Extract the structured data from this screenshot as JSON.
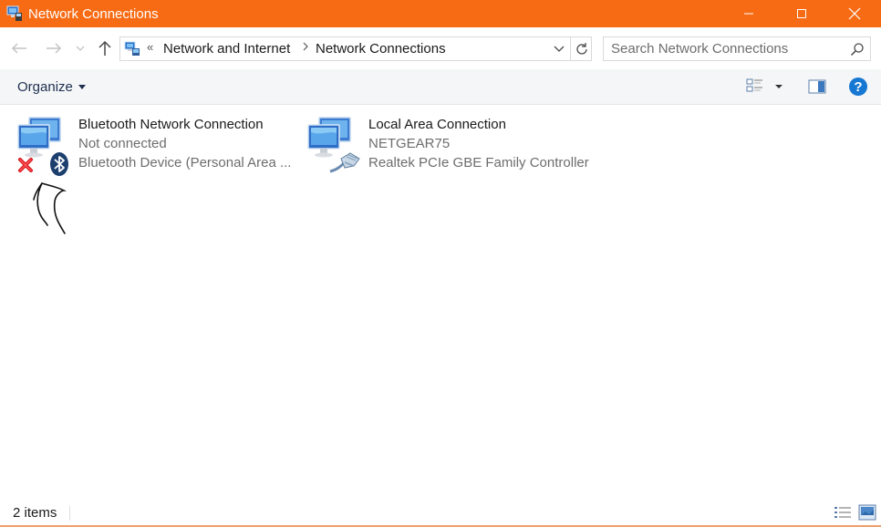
{
  "window": {
    "title": "Network Connections"
  },
  "address_bar": {
    "overflow": "«",
    "breadcrumbs": [
      "Network and Internet",
      "Network Connections"
    ]
  },
  "search": {
    "placeholder": "Search Network Connections"
  },
  "toolbar": {
    "organize_label": "Organize"
  },
  "items": [
    {
      "name": "Bluetooth Network Connection",
      "status": "Not connected",
      "device": "Bluetooth Device (Personal Area ..."
    },
    {
      "name": "Local Area Connection",
      "status": "NETGEAR75",
      "device": "Realtek PCIe GBE Family Controller"
    }
  ],
  "status_bar": {
    "item_count": "2 items"
  },
  "colors": {
    "title_bar": "#f76b14",
    "help_icon": "#1778d4"
  },
  "icons": [
    "network-connections-icon",
    "back-arrow-icon",
    "forward-arrow-icon",
    "up-arrow-icon",
    "refresh-icon",
    "search-icon",
    "change-view-icon",
    "preview-pane-icon",
    "help-icon",
    "bluetooth-icon",
    "disconnected-x-icon",
    "ethernet-cable-icon",
    "details-view-icon",
    "large-icons-view-icon"
  ]
}
